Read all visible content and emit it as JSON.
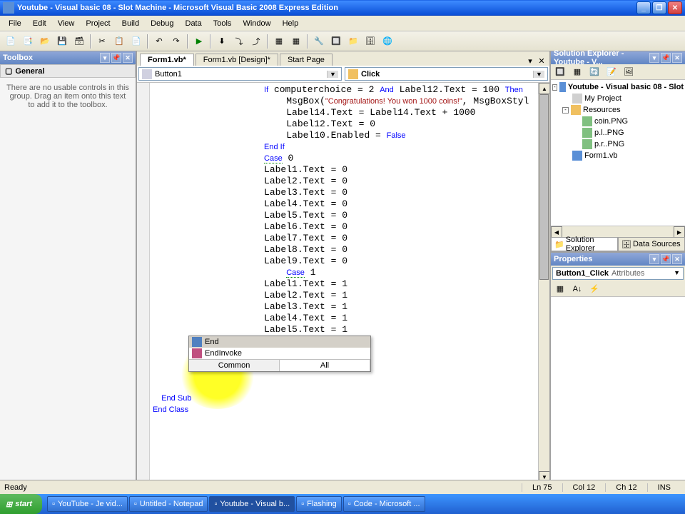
{
  "window": {
    "title": "Youtube - Visual basic 08 - Slot Machine - Microsoft Visual Basic 2008 Express Edition"
  },
  "menu": [
    "File",
    "Edit",
    "View",
    "Project",
    "Build",
    "Debug",
    "Data",
    "Tools",
    "Window",
    "Help"
  ],
  "tabs": {
    "active": "Form1.vb*",
    "items": [
      "Form1.vb*",
      "Form1.vb [Design]*",
      "Start Page"
    ]
  },
  "toolbox": {
    "title": "Toolbox",
    "group": "General",
    "message": "There are no usable controls in this group. Drag an item onto this text to add it to the toolbox."
  },
  "dropdowns": {
    "left": "Button1",
    "right": "Click"
  },
  "code_lines": [
    {
      "indent": 20,
      "parts": [
        {
          "t": "If",
          "c": "kw"
        },
        {
          "t": " computerchoice = 2 "
        },
        {
          "t": "And",
          "c": "kw"
        },
        {
          "t": " Label12.Text = 100 "
        },
        {
          "t": "Then",
          "c": "kw"
        }
      ]
    },
    {
      "indent": 24,
      "parts": [
        {
          "t": "MsgBox("
        },
        {
          "t": "\"Congratulations! You won 1000 coins!\"",
          "c": "str"
        },
        {
          "t": ", MsgBoxStyl"
        }
      ]
    },
    {
      "indent": 24,
      "parts": [
        {
          "t": "Label14.Text = Label14.Text + 1000"
        }
      ]
    },
    {
      "indent": 24,
      "parts": [
        {
          "t": "Label12.Text = 0"
        }
      ]
    },
    {
      "indent": 24,
      "parts": [
        {
          "t": "Label10.Enabled = "
        },
        {
          "t": "False",
          "c": "kw"
        }
      ]
    },
    {
      "indent": 20,
      "parts": [
        {
          "t": "End If",
          "c": "kw"
        }
      ]
    },
    {
      "indent": 20,
      "parts": [
        {
          "t": "Case",
          "c": "kw sqg"
        },
        {
          "t": " 0"
        }
      ]
    },
    {
      "indent": 20,
      "parts": [
        {
          "t": "Label1.Text = 0"
        }
      ]
    },
    {
      "indent": 20,
      "parts": [
        {
          "t": "Label2.Text = 0"
        }
      ]
    },
    {
      "indent": 20,
      "parts": [
        {
          "t": "Label3.Text = 0"
        }
      ]
    },
    {
      "indent": 20,
      "parts": [
        {
          "t": "Label4.Text = 0"
        }
      ]
    },
    {
      "indent": 20,
      "parts": [
        {
          "t": "Label5.Text = 0"
        }
      ]
    },
    {
      "indent": 20,
      "parts": [
        {
          "t": "Label6.Text = 0"
        }
      ]
    },
    {
      "indent": 20,
      "parts": [
        {
          "t": "Label7.Text = 0"
        }
      ]
    },
    {
      "indent": 20,
      "parts": [
        {
          "t": "Label8.Text = 0"
        }
      ]
    },
    {
      "indent": 20,
      "parts": [
        {
          "t": "Label9.Text = 0"
        }
      ]
    },
    {
      "indent": 24,
      "parts": [
        {
          "t": "Case",
          "c": "kw sqg"
        },
        {
          "t": " 1"
        }
      ]
    },
    {
      "indent": 20,
      "parts": [
        {
          "t": "Label1.Text = 1"
        }
      ]
    },
    {
      "indent": 20,
      "parts": [
        {
          "t": "Label2.Text = 1"
        }
      ]
    },
    {
      "indent": 20,
      "parts": [
        {
          "t": "Label3.Text = 1"
        }
      ]
    },
    {
      "indent": 20,
      "parts": [
        {
          "t": "Label4.Text = 1"
        }
      ]
    },
    {
      "indent": 20,
      "parts": [
        {
          "t": "Label5.Text = 1"
        }
      ]
    }
  ],
  "code_after": {
    "line1": "    End Sub",
    "line2": "End Class"
  },
  "intellisense": {
    "items": [
      {
        "label": "End",
        "selected": true,
        "icon_color": "#5080c0"
      },
      {
        "label": "EndInvoke",
        "selected": false,
        "icon_color": "#c05080"
      }
    ],
    "tabs": [
      "Common",
      "All"
    ],
    "active_tab": "Common"
  },
  "solution_explorer": {
    "title": "Solution Explorer - Youtube - V...",
    "tree": [
      {
        "level": 0,
        "exp": "-",
        "icon": "#5a8fd6",
        "label": "Youtube - Visual basic 08 - Slot",
        "bold": true
      },
      {
        "level": 1,
        "exp": "",
        "icon": "#d0d0d0",
        "label": "My Project"
      },
      {
        "level": 1,
        "exp": "-",
        "icon": "#f0c060",
        "label": "Resources"
      },
      {
        "level": 2,
        "exp": "",
        "icon": "#80c080",
        "label": "coin.PNG"
      },
      {
        "level": 2,
        "exp": "",
        "icon": "#80c080",
        "label": "p.l..PNG"
      },
      {
        "level": 2,
        "exp": "",
        "icon": "#80c080",
        "label": "p.r..PNG"
      },
      {
        "level": 1,
        "exp": "",
        "icon": "#5a8fd6",
        "label": "Form1.vb"
      }
    ],
    "tabs": [
      "Solution Explorer",
      "Data Sources"
    ]
  },
  "properties": {
    "title": "Properties",
    "combo": "Button1_Click",
    "combo_type": "Attributes"
  },
  "statusbar": {
    "status": "Ready",
    "ln": "Ln 75",
    "col": "Col 12",
    "ch": "Ch 12",
    "ins": "INS"
  },
  "taskbar": {
    "start": "start",
    "items": [
      {
        "label": "YouTube - Je vid...",
        "active": false
      },
      {
        "label": "Untitled - Notepad",
        "active": false
      },
      {
        "label": "Youtube - Visual b...",
        "active": true
      },
      {
        "label": "Flashing",
        "active": false
      },
      {
        "label": "Code - Microsoft ...",
        "active": false
      }
    ]
  }
}
